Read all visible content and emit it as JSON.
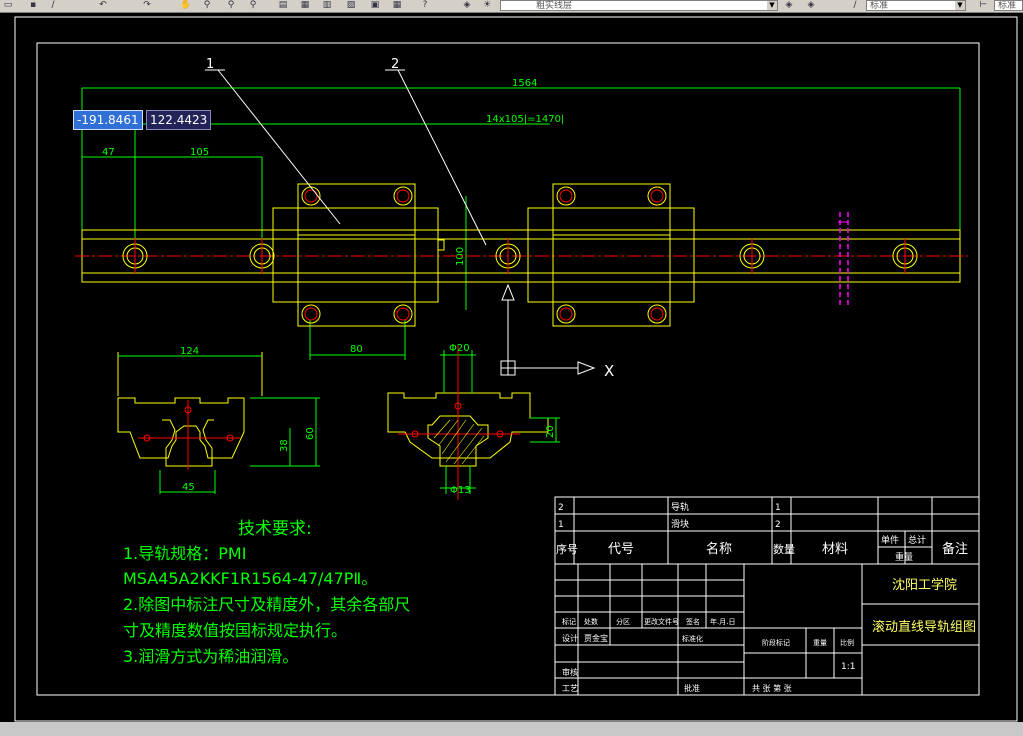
{
  "toolbar": {
    "layer_name": "粗实线层",
    "style_name": "标准",
    "style_name_right": "标准"
  },
  "coords": {
    "x": "-191.8461",
    "y": "122.4423"
  },
  "drawing": {
    "part_labels": [
      "1",
      "2"
    ],
    "dims": {
      "overall": "1564",
      "pitch": "14x105|=1470|",
      "end": "47",
      "pitch1": "105",
      "block_center": "80",
      "height": "100",
      "sec_width": "124",
      "sec_h1": "60",
      "sec_h2": "38",
      "sec_base": "45",
      "d20": "Φ20",
      "h20": "20",
      "d13": "Φ13"
    },
    "ucs_x": "X"
  },
  "tech": {
    "title": "技术要求:",
    "lines": [
      "1.导轨规格：PMI",
      "MSA45A2KKF1R1564-47/47PⅡ。",
      "2.除图中标注尺寸及精度外，其余各部尺",
      "寸及精度数值按国标规定执行。",
      "3.润滑方式为稀油润滑。"
    ]
  },
  "title_block": {
    "rows": [
      {
        "no": "2",
        "name": "导轨",
        "qty": "1"
      },
      {
        "no": "1",
        "name": "滑块",
        "qty": "2"
      }
    ],
    "headers": {
      "no": "序号",
      "code": "代号",
      "name": "名称",
      "qty": "数量",
      "material": "材料",
      "unit": "单件",
      "total": "总计",
      "weight": "重量",
      "remark": "备注"
    },
    "school": "沈阳工学院",
    "drawing_title": "滚动直线导轨组图",
    "labels": {
      "mark": "标记",
      "count": "处数",
      "zone": "分区",
      "file": "更改文件号",
      "sign": "签名",
      "date": "年.月.日",
      "design": "设计",
      "designer": "贾金宝",
      "std": "标准化",
      "stage": "阶段标记",
      "wt": "重量",
      "scale": "比例",
      "review": "审核",
      "craft": "工艺",
      "approve": "批准",
      "sheets": "共  张  第  张"
    },
    "scale_value": "1:1"
  }
}
